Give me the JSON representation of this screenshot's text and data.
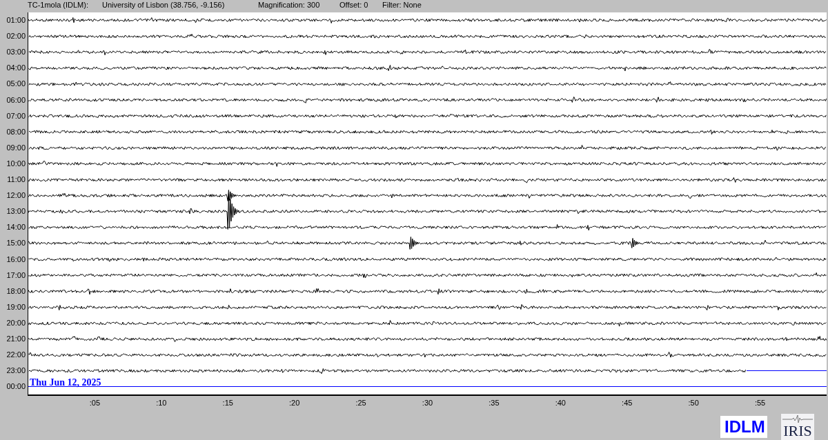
{
  "header": {
    "station": "TC-1mola (IDLM):",
    "location": "University of Lisbon (38.756, -9.156)",
    "magnification": "Magnification: 300",
    "offset": "Offset: 0",
    "filter": "Filter: None"
  },
  "rows": [
    {
      "hour": "01:00",
      "kind": "full"
    },
    {
      "hour": "02:00",
      "kind": "full"
    },
    {
      "hour": "03:00",
      "kind": "full"
    },
    {
      "hour": "04:00",
      "kind": "full"
    },
    {
      "hour": "05:00",
      "kind": "full"
    },
    {
      "hour": "06:00",
      "kind": "full"
    },
    {
      "hour": "07:00",
      "kind": "full"
    },
    {
      "hour": "08:00",
      "kind": "full"
    },
    {
      "hour": "09:00",
      "kind": "full"
    },
    {
      "hour": "10:00",
      "kind": "full"
    },
    {
      "hour": "11:00",
      "kind": "full"
    },
    {
      "hour": "12:00",
      "kind": "full"
    },
    {
      "hour": "13:00",
      "kind": "full"
    },
    {
      "hour": "14:00",
      "kind": "full"
    },
    {
      "hour": "15:00",
      "kind": "full"
    },
    {
      "hour": "16:00",
      "kind": "full"
    },
    {
      "hour": "17:00",
      "kind": "full"
    },
    {
      "hour": "18:00",
      "kind": "full"
    },
    {
      "hour": "19:00",
      "kind": "full"
    },
    {
      "hour": "20:00",
      "kind": "full"
    },
    {
      "hour": "21:00",
      "kind": "full"
    },
    {
      "hour": "22:00",
      "kind": "full"
    },
    {
      "hour": "23:00",
      "kind": "partial",
      "level": 0.9
    },
    {
      "hour": "00:00",
      "kind": "empty"
    }
  ],
  "date": "Thu Jun 12, 2025",
  "minute_ticks": [
    ":05",
    ":10",
    ":15",
    ":20",
    ":25",
    ":30",
    ":35",
    ":40",
    ":45",
    ":50",
    ":55"
  ],
  "logos": {
    "station": "IDLM",
    "network": "IRIS"
  }
}
